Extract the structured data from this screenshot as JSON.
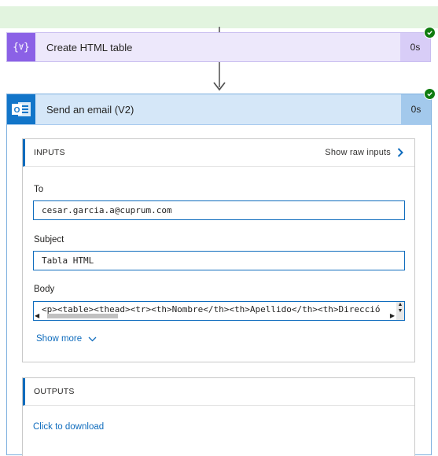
{
  "flow": {
    "actions": [
      {
        "title": "Create HTML table",
        "duration": "0s",
        "icon": "data-operation-icon",
        "status": "succeeded"
      },
      {
        "title": "Send an email (V2)",
        "duration": "0s",
        "icon": "outlook-icon",
        "status": "succeeded"
      }
    ]
  },
  "inputs": {
    "header": "INPUTS",
    "show_raw": "Show raw inputs",
    "fields": [
      {
        "label": "To",
        "value": "cesar.garcia.a@cuprum.com"
      },
      {
        "label": "Subject",
        "value": "Tabla HTML"
      },
      {
        "label": "Body",
        "value": "<p><table><thead><tr><th>Nombre</th><th>Apellido</th><th>Direcció"
      }
    ],
    "show_more": "Show more"
  },
  "outputs": {
    "header": "OUTPUTS",
    "download": "Click to download"
  },
  "colors": {
    "success": "#107c10",
    "accent": "#0f6cbd",
    "data_operation": "#8b61e6",
    "outlook": "#1275c9"
  }
}
